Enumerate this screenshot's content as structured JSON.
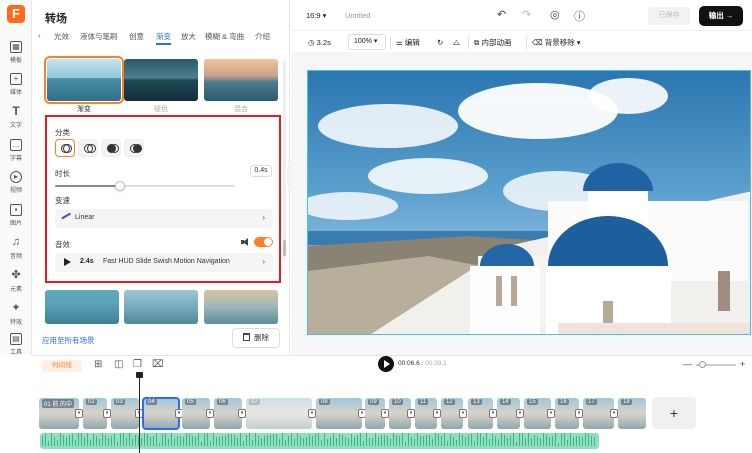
{
  "rail": {
    "logo": "F",
    "items": [
      {
        "label": "模板",
        "icon": "template-icon"
      },
      {
        "label": "媒体",
        "icon": "media-icon"
      },
      {
        "label": "文字",
        "icon": "text-icon"
      },
      {
        "label": "字幕",
        "icon": "subtitle-icon"
      },
      {
        "label": "视频",
        "icon": "video-icon"
      },
      {
        "label": "图片",
        "icon": "image-icon"
      },
      {
        "label": "音频",
        "icon": "audio-icon"
      },
      {
        "label": "元素",
        "icon": "elements-icon"
      },
      {
        "label": "特效",
        "icon": "effects-icon"
      },
      {
        "label": "工具",
        "icon": "tools-icon"
      }
    ]
  },
  "panel": {
    "title": "转场",
    "tabs": [
      "光效",
      "液体与笔刷",
      "创意",
      "渐变",
      "放大",
      "模糊 & 弯曲",
      "介绍"
    ],
    "active_tab": "渐变",
    "thumbnails_row1": [
      {
        "label": "渐变",
        "selected": true
      },
      {
        "label": "褪色",
        "selected": false
      },
      {
        "label": "混合",
        "selected": false
      }
    ],
    "settings": {
      "category_label": "分类",
      "duration_label": "时长",
      "duration_value": "0.4s",
      "duration_fraction": 0.36,
      "easing_label": "变速",
      "easing_value": "Linear",
      "sound_label": "音效",
      "sound_duration": "2.4s",
      "sound_name": "Fast HUD Slide Swish Motion Navigation",
      "sound_enabled": true
    },
    "apply_all": "应用至所有场景",
    "delete": "删除"
  },
  "topbar": {
    "ratio": "16:9 ▾",
    "doc_title": "Untitled",
    "saved": "已保存",
    "export": "输出"
  },
  "toolbar": {
    "duration": "3.2s",
    "zoom": "100%",
    "edit": "编辑",
    "inner_animation": "内部动画",
    "bg_remove": "背景移除"
  },
  "timeline": {
    "badge": "时间线",
    "current": "00:06.6",
    "total": "/ 00:39.1",
    "first_clip_text": "01 前 的中",
    "clips": [
      "01",
      "02",
      "03",
      "04",
      "05",
      "06",
      "07",
      "08",
      "09",
      "10",
      "11",
      "12",
      "13",
      "14",
      "15",
      "16",
      "17",
      "18"
    ],
    "selected_clip": "04",
    "add_label": "+"
  },
  "colors": {
    "accent": "#ff7f2a",
    "selection": "#2a6df4",
    "highlight_box": "#e02020",
    "canvas_border": "#44c4d6"
  }
}
